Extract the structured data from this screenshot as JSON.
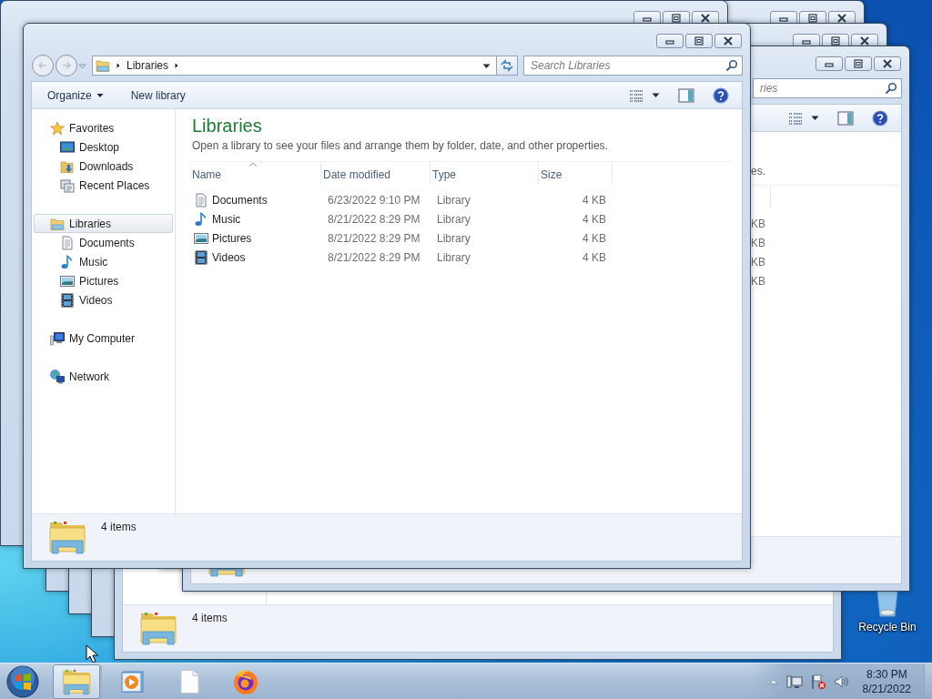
{
  "background_windows": [
    {
      "kind": "frame"
    },
    {
      "kind": "frame"
    },
    {
      "kind": "frame"
    },
    {
      "kind": "footer",
      "status": "4 items"
    },
    {
      "kind": "titlebar"
    },
    {
      "kind": "titlebar"
    },
    {
      "kind": "titlebar"
    },
    {
      "kind": "explorer",
      "search_placeholder": "ries",
      "description": "es.",
      "sizes": [
        "KB",
        "KB",
        "KB",
        "KB"
      ]
    }
  ],
  "main_window": {
    "address": {
      "crumbs": [
        "Libraries"
      ]
    },
    "search": {
      "placeholder": "Search Libraries"
    },
    "commands": [
      {
        "label": "Organize",
        "kind": "menu"
      },
      {
        "label": "New library",
        "kind": "button"
      }
    ],
    "nav": [
      {
        "label": "Favorites",
        "kind": "star",
        "selected": false,
        "children": [
          {
            "label": "Desktop",
            "kind": "desktop",
            "selected": false
          },
          {
            "label": "Downloads",
            "kind": "downloads",
            "selected": false
          },
          {
            "label": "Recent Places",
            "kind": "recent",
            "selected": false
          }
        ]
      },
      {
        "label": "Libraries",
        "kind": "library",
        "selected": true,
        "children": [
          {
            "label": "Documents",
            "kind": "documents",
            "selected": false
          },
          {
            "label": "Music",
            "kind": "music",
            "selected": false
          },
          {
            "label": "Pictures",
            "kind": "pictures",
            "selected": false
          },
          {
            "label": "Videos",
            "kind": "videos",
            "selected": false
          }
        ]
      },
      {
        "label": "My Computer",
        "kind": "computer",
        "selected": false
      },
      {
        "label": "Network",
        "kind": "network",
        "selected": false
      }
    ],
    "heading": "Libraries",
    "description": "Open a library to see your files and arrange them by folder, date, and other properties.",
    "columns": [
      {
        "label": "Name",
        "sorted": true
      },
      {
        "label": "Date modified",
        "sorted": false
      },
      {
        "label": "Type",
        "sorted": false
      },
      {
        "label": "Size",
        "sorted": false
      }
    ],
    "rows": [
      {
        "kind": "documents",
        "name": "Documents",
        "date": "6/23/2022 9:10 PM",
        "type": "Library",
        "size": "4 KB"
      },
      {
        "kind": "music",
        "name": "Music",
        "date": "8/21/2022 8:29 PM",
        "type": "Library",
        "size": "4 KB"
      },
      {
        "kind": "pictures",
        "name": "Pictures",
        "date": "8/21/2022 8:29 PM",
        "type": "Library",
        "size": "4 KB"
      },
      {
        "kind": "videos",
        "name": "Videos",
        "date": "8/21/2022 8:29 PM",
        "type": "Library",
        "size": "4 KB"
      }
    ],
    "status": "4 items"
  },
  "desktop_icons": [
    {
      "label": "Recycle Bin"
    }
  ],
  "taskbar": {
    "buttons": [
      {
        "kind": "explorer",
        "selected": true
      },
      {
        "kind": "media",
        "selected": false
      },
      {
        "kind": "document",
        "selected": false
      },
      {
        "kind": "browser",
        "selected": false
      }
    ],
    "clock": {
      "time": "8:30 PM",
      "date": "8/21/2022"
    }
  }
}
